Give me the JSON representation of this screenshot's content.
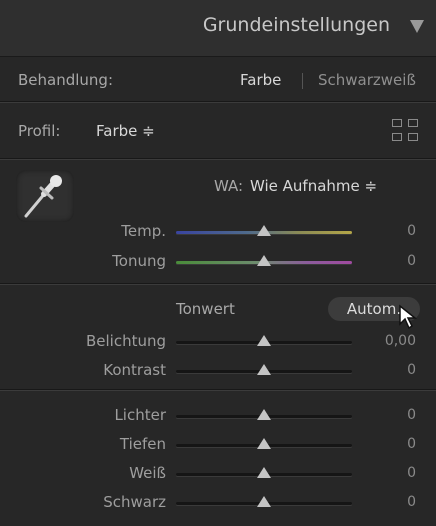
{
  "panel": {
    "title": "Grundeinstellungen",
    "treatment": {
      "label": "Behandlung:",
      "color": "Farbe",
      "bw": "Schwarzweiß"
    },
    "profile": {
      "label": "Profil:",
      "value": "Farbe ≑"
    },
    "wb": {
      "label": "WA:",
      "value": "Wie Aufnahme ≑"
    },
    "sliders_wb": [
      {
        "label": "Temp.",
        "value": "0",
        "position": 0.5
      },
      {
        "label": "Tonung",
        "value": "0",
        "position": 0.5
      }
    ],
    "tone": {
      "label": "Tonwert",
      "auto": "Autom."
    },
    "sliders_tone": [
      {
        "label": "Belichtung",
        "value": "0,00",
        "position": 0.5
      },
      {
        "label": "Kontrast",
        "value": "0",
        "position": 0.5
      }
    ],
    "sliders_presence": [
      {
        "label": "Lichter",
        "value": "0",
        "position": 0.5
      },
      {
        "label": "Tiefen",
        "value": "0",
        "position": 0.5
      },
      {
        "label": "Weiß",
        "value": "0",
        "position": 0.5
      },
      {
        "label": "Schwarz",
        "value": "0",
        "position": 0.5
      }
    ]
  }
}
